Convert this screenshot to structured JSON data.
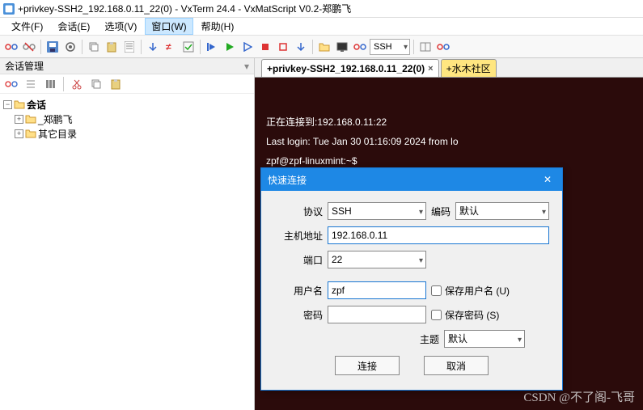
{
  "window": {
    "title": "+privkey-SSH2_192.168.0.11_22(0) - VxTerm 24.4 - VxMatScript V0.2-郑鹏飞"
  },
  "menu": {
    "file": "文件(F)",
    "session": "会话(E)",
    "options": "选项(V)",
    "window": "窗口(W)",
    "help": "帮助(H)"
  },
  "toolbar": {
    "combo_ssh": "SSH"
  },
  "sidebar": {
    "title": "会话管理",
    "tree": {
      "root": "会话",
      "child1": "_郑鹏飞",
      "child2": "其它目录"
    }
  },
  "tabs": {
    "active": "+privkey-SSH2_192.168.0.11_22(0)",
    "inactive": "+水木社区"
  },
  "terminal": {
    "l1": "正在连接到:192.168.0.11:22",
    "l2": "Last login: Tue Jan 30 01:16:09 2024 from lo",
    "l3": "zpf@zpf-linuxmint:~$"
  },
  "dialog": {
    "title": "快速连接",
    "protocol_label": "协议",
    "protocol_value": "SSH",
    "encoding_label": "编码",
    "encoding_value": "默认",
    "host_label": "主机地址",
    "host_value": "192.168.0.11",
    "port_label": "端口",
    "port_value": "22",
    "user_label": "用户名",
    "user_value": "zpf",
    "save_user": "保存用户名 (U)",
    "pass_label": "密码",
    "pass_value": "",
    "save_pass": "保存密码 (S)",
    "theme_label": "主题",
    "theme_value": "默认",
    "connect": "连接",
    "cancel": "取消"
  },
  "watermark": "CSDN @不了阁-飞哥"
}
